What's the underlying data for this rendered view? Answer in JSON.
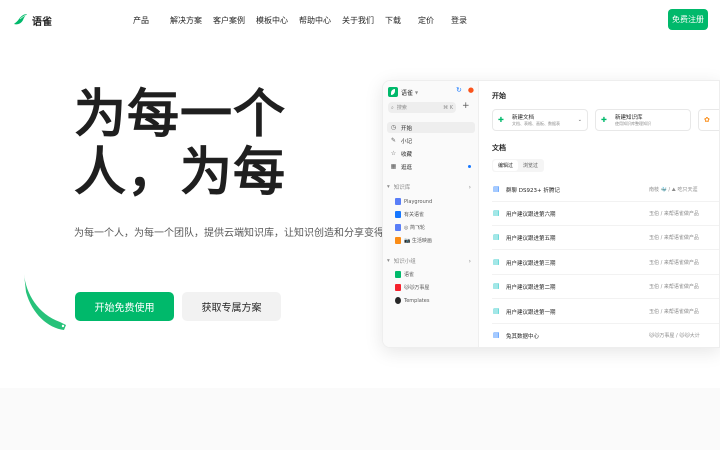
{
  "brand": {
    "name": "语雀",
    "color": "#00b96b"
  },
  "nav": {
    "items": [
      "产品",
      "解决方案",
      "客户案例",
      "模板中心",
      "帮助中心",
      "关于我们",
      "下载",
      "定价",
      "登录"
    ],
    "cta": "免费注册"
  },
  "hero": {
    "title_line1": "为每一个",
    "title_line2": "人，为每",
    "subtitle": "为每一个人，为每一个团队，提供云端知识库，让知识创造和分享变得简单",
    "primary_button": "开始免费使用",
    "secondary_button": "获取专属方案"
  },
  "app": {
    "sidebar": {
      "title": "语雀",
      "search_placeholder": "搜索",
      "search_shortcut": "⌘ K",
      "nav": [
        {
          "icon": "clock-icon",
          "label": "开始"
        },
        {
          "icon": "pen-icon",
          "label": "小记"
        },
        {
          "icon": "star-icon",
          "label": "收藏"
        },
        {
          "icon": "grid-icon",
          "label": "逛逛"
        }
      ],
      "group_kb": "知识库",
      "kbs": [
        {
          "label": "Playground",
          "color": "#597ef7"
        },
        {
          "label": "有关语雀",
          "color": "#1677ff"
        },
        {
          "label": "◎ 简飞轮",
          "color": "#597ef7"
        },
        {
          "label": "📷 生活映画",
          "color": "#fa8c16"
        }
      ],
      "group_team": "知识小组",
      "teams": [
        {
          "label": "语雀",
          "color": "#00b96b"
        },
        {
          "label": "🐱🐱万事屋",
          "color": "#f5222d"
        },
        {
          "label": "Templates",
          "color": "#262626"
        }
      ]
    },
    "main": {
      "heading": "开始",
      "cards": [
        {
          "title": "新建文档",
          "sub": "文档、表格、画板、数据表"
        },
        {
          "title": "新建知识库",
          "sub": "使用知识库整理知识"
        },
        {
          "title": "",
          "sub": ""
        }
      ],
      "docs_heading": "文档",
      "tabs": [
        "编辑过",
        "浏览过"
      ],
      "docs": [
        {
          "title": "群聊 DS923+ 折腾记",
          "meta": "南枝 🐳 / ⛰ 吃只天涯"
        },
        {
          "title": "用户建议跟进第六期",
          "meta": "玉伯 / 来帮语雀做产品"
        },
        {
          "title": "用户建议跟进第五期",
          "meta": "玉伯 / 来帮语雀做产品"
        },
        {
          "title": "用户建议跟进第三期",
          "meta": "玉伯 / 来帮语雀做产品"
        },
        {
          "title": "用户建议跟进第二期",
          "meta": "玉伯 / 来帮语雀做产品"
        },
        {
          "title": "用户建议跟进第一期",
          "meta": "玉伯 / 来帮语雀做产品"
        },
        {
          "title": "兔其数据中心",
          "meta": "🐱🐱万事屋 / 🐱🐱大计"
        }
      ]
    }
  }
}
